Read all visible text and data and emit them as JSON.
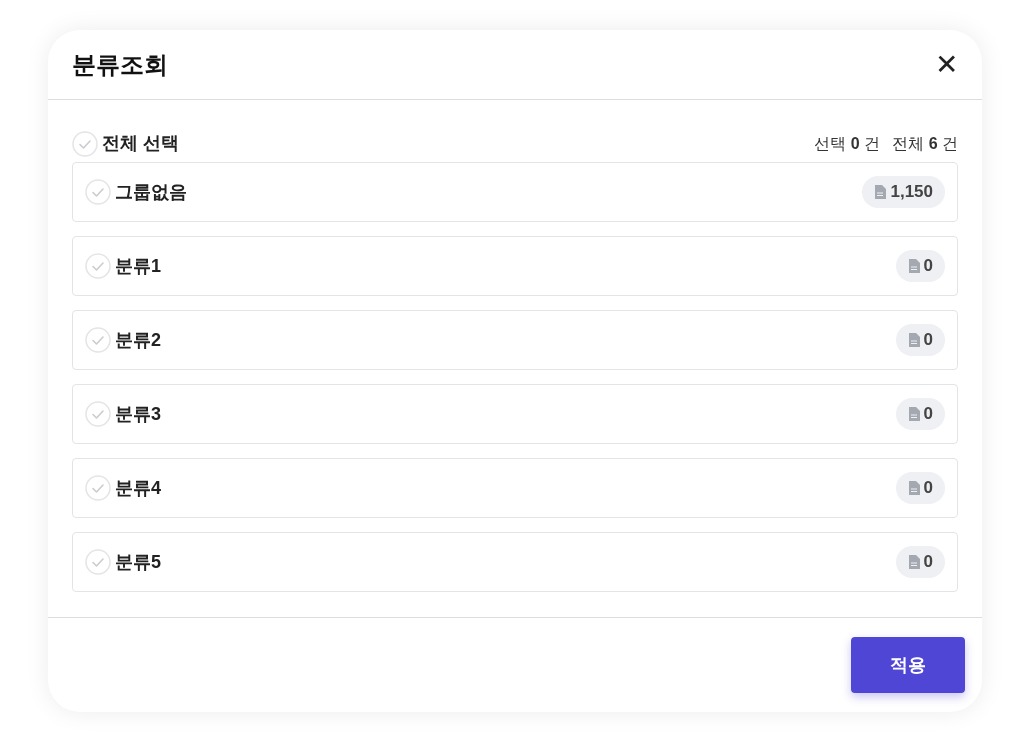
{
  "dialog": {
    "title": "분류조회",
    "close": "✕"
  },
  "select_all": {
    "label": "전체 선택",
    "checked": false
  },
  "summary": [
    "선택 **0** 건",
    "전체 **6** 건"
  ],
  "items": [
    {
      "label": "그룹없음",
      "count": "1,150",
      "checked": false
    },
    {
      "label": "분류1",
      "count": "0",
      "checked": false
    },
    {
      "label": "분류2",
      "count": "0",
      "checked": false
    },
    {
      "label": "분류3",
      "count": "0",
      "checked": false
    },
    {
      "label": "분류4",
      "count": "0",
      "checked": false
    },
    {
      "label": "분류5",
      "count": "0",
      "checked": false
    }
  ],
  "apply_button": "적용"
}
